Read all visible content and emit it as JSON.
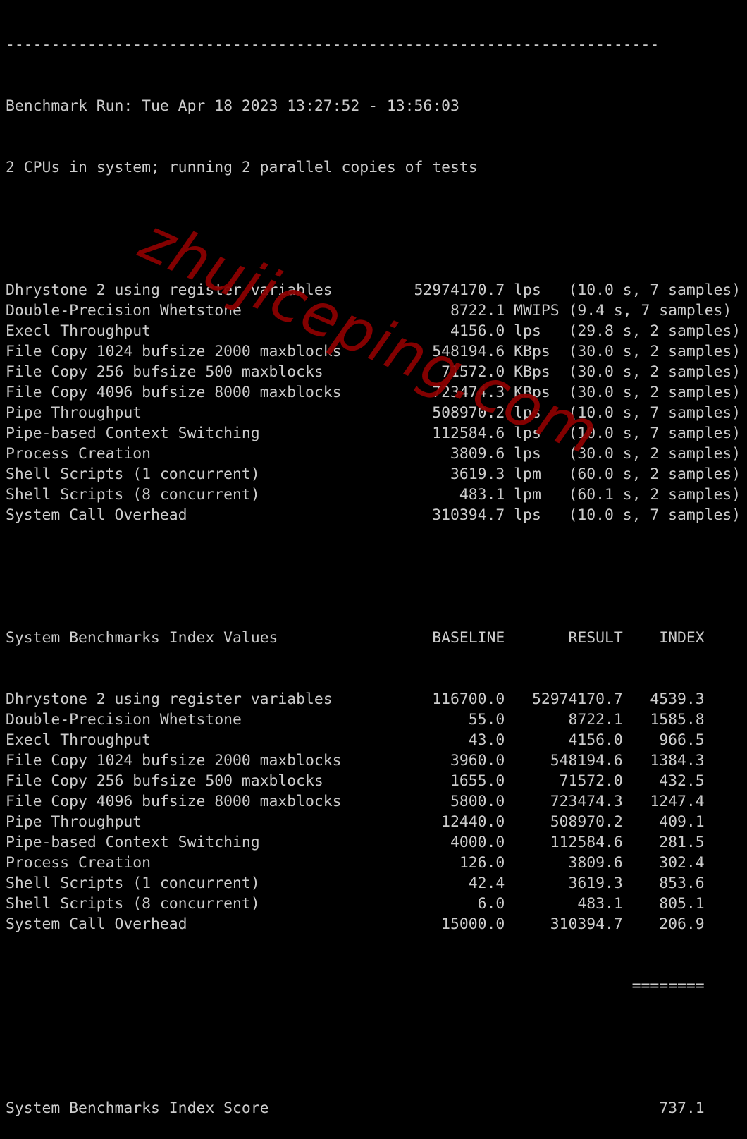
{
  "separator": "------------------------------------------------------------------------",
  "header": {
    "run_line": "Benchmark Run: Tue Apr 18 2023 13:27:52 - 13:56:03",
    "cpu_line": "2 CPUs in system; running 2 parallel copies of tests"
  },
  "results": [
    {
      "name": "Dhrystone 2 using register variables",
      "value": "52974170.7",
      "unit": "lps",
      "detail": "(10.0 s, 7 samples)"
    },
    {
      "name": "Double-Precision Whetstone",
      "value": "8722.1",
      "unit": "MWIPS",
      "detail": "(9.4 s, 7 samples)"
    },
    {
      "name": "Execl Throughput",
      "value": "4156.0",
      "unit": "lps",
      "detail": "(29.8 s, 2 samples)"
    },
    {
      "name": "File Copy 1024 bufsize 2000 maxblocks",
      "value": "548194.6",
      "unit": "KBps",
      "detail": "(30.0 s, 2 samples)"
    },
    {
      "name": "File Copy 256 bufsize 500 maxblocks",
      "value": "71572.0",
      "unit": "KBps",
      "detail": "(30.0 s, 2 samples)"
    },
    {
      "name": "File Copy 4096 bufsize 8000 maxblocks",
      "value": "723474.3",
      "unit": "KBps",
      "detail": "(30.0 s, 2 samples)"
    },
    {
      "name": "Pipe Throughput",
      "value": "508970.2",
      "unit": "lps",
      "detail": "(10.0 s, 7 samples)"
    },
    {
      "name": "Pipe-based Context Switching",
      "value": "112584.6",
      "unit": "lps",
      "detail": "(10.0 s, 7 samples)"
    },
    {
      "name": "Process Creation",
      "value": "3809.6",
      "unit": "lps",
      "detail": "(30.0 s, 2 samples)"
    },
    {
      "name": "Shell Scripts (1 concurrent)",
      "value": "3619.3",
      "unit": "lpm",
      "detail": "(60.0 s, 2 samples)"
    },
    {
      "name": "Shell Scripts (8 concurrent)",
      "value": "483.1",
      "unit": "lpm",
      "detail": "(60.1 s, 2 samples)"
    },
    {
      "name": "System Call Overhead",
      "value": "310394.7",
      "unit": "lps",
      "detail": "(10.0 s, 7 samples)"
    }
  ],
  "index_table": {
    "title": "System Benchmarks Index Values",
    "columns": [
      "BASELINE",
      "RESULT",
      "INDEX"
    ],
    "rows": [
      {
        "name": "Dhrystone 2 using register variables",
        "baseline": "116700.0",
        "result": "52974170.7",
        "index": "4539.3"
      },
      {
        "name": "Double-Precision Whetstone",
        "baseline": "55.0",
        "result": "8722.1",
        "index": "1585.8"
      },
      {
        "name": "Execl Throughput",
        "baseline": "43.0",
        "result": "4156.0",
        "index": "966.5"
      },
      {
        "name": "File Copy 1024 bufsize 2000 maxblocks",
        "baseline": "3960.0",
        "result": "548194.6",
        "index": "1384.3"
      },
      {
        "name": "File Copy 256 bufsize 500 maxblocks",
        "baseline": "1655.0",
        "result": "71572.0",
        "index": "432.5"
      },
      {
        "name": "File Copy 4096 bufsize 8000 maxblocks",
        "baseline": "5800.0",
        "result": "723474.3",
        "index": "1247.4"
      },
      {
        "name": "Pipe Throughput",
        "baseline": "12440.0",
        "result": "508970.2",
        "index": "409.1"
      },
      {
        "name": "Pipe-based Context Switching",
        "baseline": "4000.0",
        "result": "112584.6",
        "index": "281.5"
      },
      {
        "name": "Process Creation",
        "baseline": "126.0",
        "result": "3809.6",
        "index": "302.4"
      },
      {
        "name": "Shell Scripts (1 concurrent)",
        "baseline": "42.4",
        "result": "3619.3",
        "index": "853.6"
      },
      {
        "name": "Shell Scripts (8 concurrent)",
        "baseline": "6.0",
        "result": "483.1",
        "index": "805.1"
      },
      {
        "name": "System Call Overhead",
        "baseline": "15000.0",
        "result": "310394.7",
        "index": "206.9"
      }
    ],
    "rule": "========",
    "score_label": "System Benchmarks Index Score",
    "score": "737.1"
  },
  "watermark": "zhujiceping.com",
  "colors": {
    "background": "#000000",
    "text": "#cccccc",
    "watermark": "#8b0000"
  }
}
